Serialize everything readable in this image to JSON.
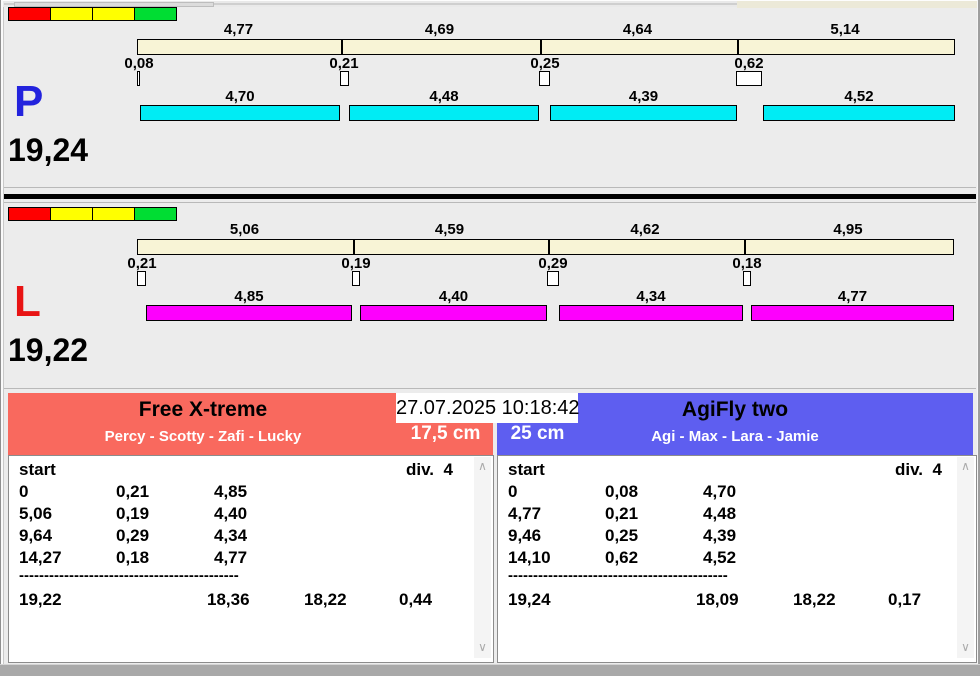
{
  "colors": {
    "legend": [
      "#ff0000",
      "#ffff00",
      "#ffff00",
      "#00dd33"
    ],
    "split_bar": "#f8f4d6",
    "changeover_box": "#ffffff",
    "lane_p_run": "#00ecf4",
    "lane_l_run": "#fd00fd",
    "team_left": "#f9695e",
    "team_right": "#5e5ef0",
    "bottom_bar": "#a9a9a9"
  },
  "lanes": [
    {
      "letter": "P",
      "letter_color": "#2323dd",
      "total": "19,24",
      "run_color": "#00ecf4",
      "splits": [
        "4,77",
        "4,69",
        "4,64",
        "5,14"
      ],
      "changeovers": [
        "0,08",
        "0,21",
        "0,25",
        "0,62"
      ],
      "runs": [
        "4,70",
        "4,48",
        "4,39",
        "4,52"
      ]
    },
    {
      "letter": "L",
      "letter_color": "#e81414",
      "total": "19,22",
      "run_color": "#fd00fd",
      "splits": [
        "5,06",
        "4,59",
        "4,62",
        "4,95"
      ],
      "changeovers": [
        "0,21",
        "0,19",
        "0,29",
        "0,18"
      ],
      "runs": [
        "4,85",
        "4,40",
        "4,34",
        "4,77"
      ]
    }
  ],
  "clock": {
    "datetime": "27.07.2025 10:18:42"
  },
  "teams": [
    {
      "name": "Free X-treme",
      "dogs": "Percy - Scotty - Zafi - Lucky",
      "jump_height": "17,5 cm",
      "header_color": "#f9695e",
      "table": {
        "start_label": "start",
        "div_label": "div.  4",
        "rows": [
          [
            "0",
            "0,21",
            "4,85"
          ],
          [
            "5,06",
            "0,19",
            "4,40"
          ],
          [
            "9,64",
            "0,29",
            "4,34"
          ],
          [
            "14,27",
            "0,18",
            "4,77"
          ]
        ],
        "separator": "--------------------------------------------",
        "totals": [
          "19,22",
          "18,36",
          "18,22",
          "0,44"
        ]
      }
    },
    {
      "name": "AgiFly two",
      "dogs": "Agi - Max - Lara - Jamie",
      "jump_height": "25 cm",
      "header_color": "#5e5ef0",
      "table": {
        "start_label": "start",
        "div_label": "div.  4",
        "rows": [
          [
            "0",
            "0,08",
            "4,70"
          ],
          [
            "4,77",
            "0,21",
            "4,48"
          ],
          [
            "9,46",
            "0,25",
            "4,39"
          ],
          [
            "14,10",
            "0,62",
            "4,52"
          ]
        ],
        "separator": "--------------------------------------------",
        "totals": [
          "19,24",
          "18,09",
          "18,22",
          "0,17"
        ]
      }
    }
  ],
  "icons": {
    "scroll_up": "∧",
    "scroll_down": "∨"
  }
}
